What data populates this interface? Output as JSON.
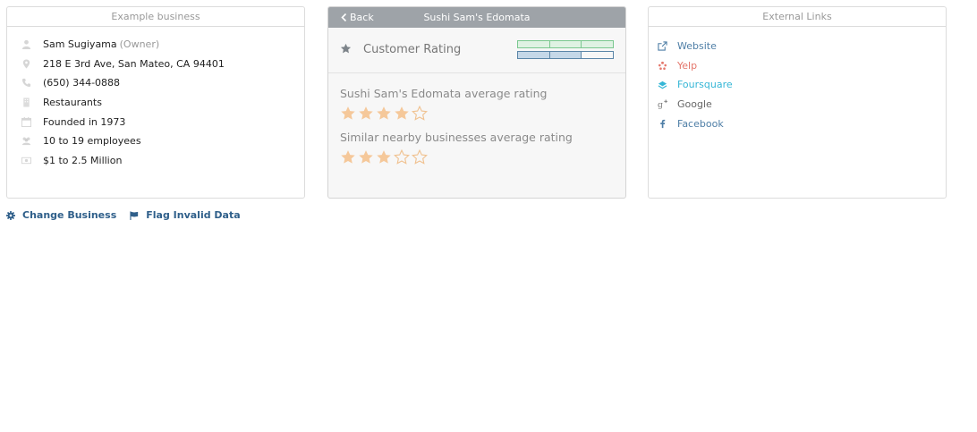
{
  "business_card": {
    "title": "Example business",
    "owner_name": "Sam Sugiyama",
    "owner_role": "(Owner)",
    "address": "218 E 3rd Ave, San Mateo, CA 94401",
    "phone": "(650) 344-0888",
    "category": "Restaurants",
    "founded": "Founded in 1973",
    "employees": "10 to 19 employees",
    "revenue": "$1 to 2.5 Million"
  },
  "rating_card": {
    "back_label": "Back",
    "business_name": "Sushi Sam's Edomata",
    "section_title": "Customer Rating",
    "business_rating_label": "Sushi Sam's Edomata average rating",
    "business_rating_stars": 4,
    "nearby_rating_label": "Similar nearby businesses average rating",
    "nearby_rating_stars": 3,
    "max_stars": 5,
    "colors": {
      "star_fill": "#f5c89a",
      "star_outline": "#f0c291",
      "bar_green": "#7ac88f",
      "bar_blue": "#5b86a8"
    }
  },
  "links_card": {
    "title": "External Links",
    "links": [
      {
        "label": "Website",
        "icon": "external-link-icon",
        "color": "#4e7ea6"
      },
      {
        "label": "Yelp",
        "icon": "yelp-icon",
        "color": "#e4766b"
      },
      {
        "label": "Foursquare",
        "icon": "foursquare-icon",
        "color": "#35b6d6"
      },
      {
        "label": "Google",
        "icon": "google-plus-icon",
        "color": "#777777"
      },
      {
        "label": "Facebook",
        "icon": "facebook-icon",
        "color": "#4e7ea6"
      }
    ]
  },
  "actions": {
    "change_business": "Change Business",
    "flag_invalid": "Flag Invalid Data"
  }
}
